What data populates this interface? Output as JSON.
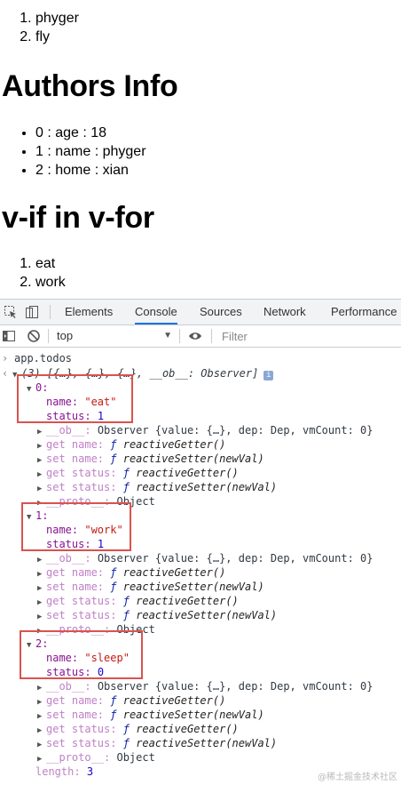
{
  "page": {
    "list1": [
      "phyger",
      "fly"
    ],
    "heading1": "Authors Info",
    "authors": [
      "0 : age : 18",
      "1 : name : phyger",
      "2 : home : xian"
    ],
    "heading2": "v-if in v-for",
    "list2": [
      "eat",
      "work"
    ]
  },
  "devtools": {
    "tabs": [
      "Elements",
      "Console",
      "Sources",
      "Network",
      "Performance"
    ],
    "active_tab": "Console",
    "context": "top",
    "filter_placeholder": "Filter",
    "command": "app.todos",
    "result_summary": "(3) [{…}, {…}, {…}, __ob__: Observer]",
    "info_badge": "i",
    "items": [
      {
        "index": "0:",
        "name": "\"eat\"",
        "status": "1"
      },
      {
        "index": "1:",
        "name": "\"work\"",
        "status": "1"
      },
      {
        "index": "2:",
        "name": "\"sleep\"",
        "status": "0"
      }
    ],
    "labels": {
      "name": "name:",
      "status": "status:",
      "ob": "__ob__:",
      "ob_value": "Observer {value: {…}, dep: Dep, vmCount: 0}",
      "get_name": "get name:",
      "set_name": "set name:",
      "get_status": "get status:",
      "set_status": "set status:",
      "f": "ƒ",
      "getter": "reactiveGetter()",
      "setter": "reactiveSetter(newVal)",
      "proto": "__proto__:",
      "proto_value": "Object",
      "length_key": "length:",
      "length_value": "3"
    },
    "highlight_color": "#d9534f"
  },
  "watermark": "@稀土掘金技术社区"
}
